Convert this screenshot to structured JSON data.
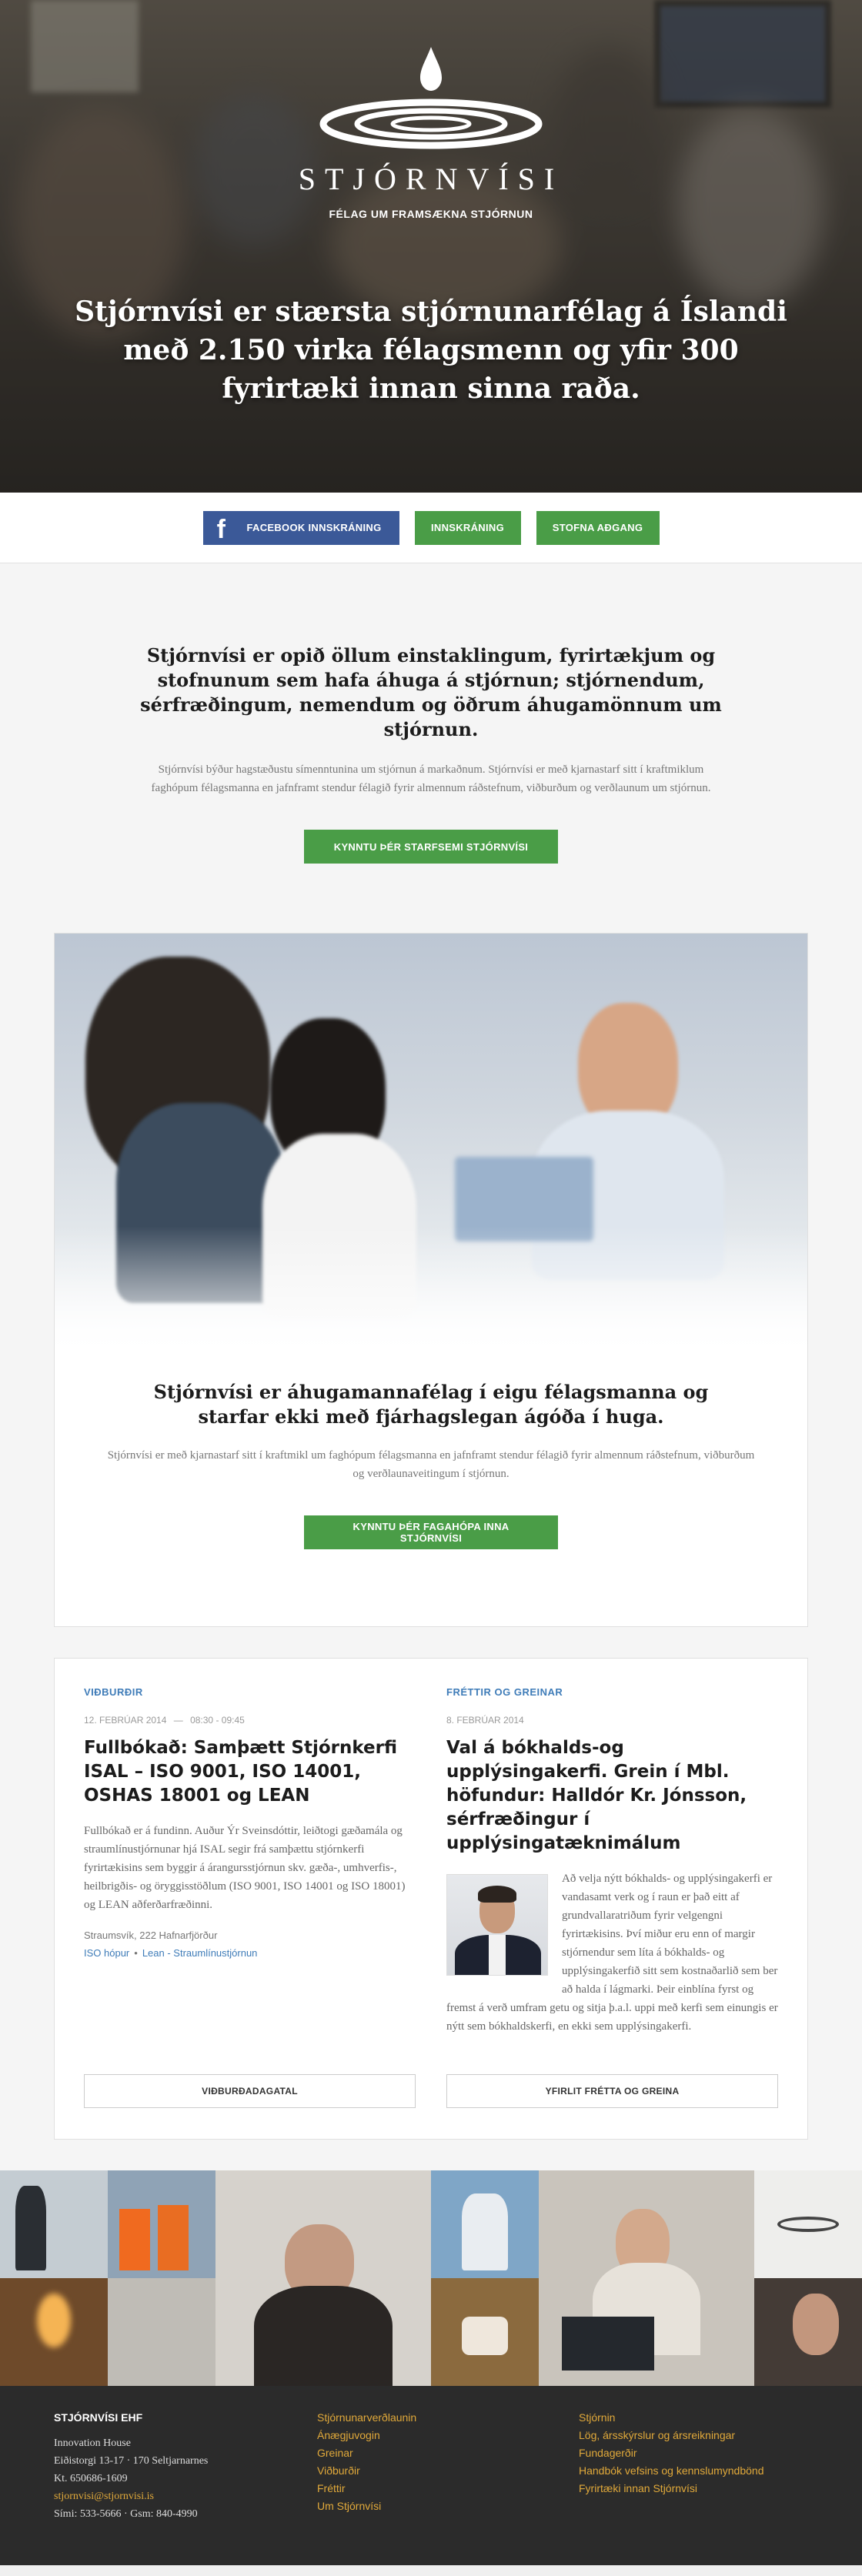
{
  "hero": {
    "wordmark": "STJÓRNVÍSI",
    "tagline": "FÉLAG UM FRAMSÆKNA STJÓRNUN",
    "headline": "Stjórnvísi er stærsta stjórnunarfélag á Íslandi með 2.150 virka félagsmenn og yfir 300 fyrirtæki innan sinna raða."
  },
  "actions": {
    "facebook_label": "FACEBOOK INNSKRÁNING",
    "facebook_glyph": "f",
    "login_label": "INNSKRÁNING",
    "signup_label": "STOFNA AÐGANG"
  },
  "intro": {
    "heading": "Stjórnvísi er opið öllum einstaklingum, fyrirtækjum og stofnunum sem hafa áhuga á stjórnun; stjórnendum, sérfræðingum, nemendum og öðrum áhugamönnum um stjórnun.",
    "body": "Stjórnvísi býður hagstæðustu símenntunina um stjórnun á markaðnum. Stjórnvísi er með kjarnastarf sitt í kraftmiklum faghópum félagsmanna en jafnframt stendur félagið fyrir almennum ráðstefnum, viðburðum og verðlaunum um stjórnun.",
    "cta": "KYNNTU ÞÉR STARFSEMI STJÓRNVÍSI"
  },
  "feature": {
    "heading": "Stjórnvísi er áhugamannafélag í eigu félagsmanna og starfar ekki með fjárhagslegan ágóða í huga.",
    "body": "Stjórnvísi er með kjarnastarf sitt í kraftmikl um faghópum félagsmanna en jafnframt stendur félagið fyrir almennum ráðstefnum, viðburðum og verðlaunaveitingum í stjórnun.",
    "cta": "KYNNTU ÞÉR FAGAHÓPA INNA STJÓRNVÍSI"
  },
  "news": {
    "events": {
      "kicker": "VIÐBURÐIR",
      "date": "12. FEBRÚAR 2014",
      "time": "08:30 - 09:45",
      "title": "Fullbókað: Samþætt Stjórnkerfi ISAL – ISO 9001, ISO 14001, OSHAS 18001 og LEAN",
      "body": "Fullbókað er á fundinn. Auður Ýr Sveinsdóttir, leiðtogi gæðamála og straumlínustjórnunar hjá ISAL segir frá samþættu stjórnkerfi fyrirtækisins sem byggir á árangursstjórnun skv. gæða-, umhverfis-, heilbrigðis- og öryggisstöðlum (ISO 9001, ISO 14001 og ISO 18001) og LEAN aðferðarfræðinni.",
      "location": "Straumsvík, 222 Hafnarfjörður",
      "tags": [
        "ISO hópur",
        "Lean - Straumlínustjórnun"
      ],
      "button": "VIÐBURÐADAGATAL"
    },
    "articles": {
      "kicker": "FRÉTTIR OG GREINAR",
      "date": "8. FEBRÚAR 2014",
      "title": "Val á bókhalds-og upplýsingakerfi. Grein í Mbl. höfundur: Halldór Kr. Jónsson, sérfræðingur í upplýsingatæknimálum",
      "body": "Að velja nýtt bókhalds- og upplýsingakerfi er vandasamt verk og í raun er það eitt af grundvallaratriðum fyrir velgengni fyrirtækisins. Því miður eru enn of margir stjórnendur sem líta á bókhalds- og upplýsingakerfið sitt sem kostnaðarlið sem ber að halda í lágmarki. Þeir einblína fyrst og fremst á verð umfram getu og sitja þ.a.l. uppi með kerfi sem einungis er nýtt sem bókhaldskerfi, en ekki sem upplýsingakerfi.",
      "button": "YFIRLIT FRÉTTA OG GREINA"
    }
  },
  "footer": {
    "company": {
      "title": "STJÓRNVÍSI EHF",
      "lines": [
        "Innovation House",
        "Eiðistorgi 13-17 · 170 Seltjarnarnes",
        "Kt. 650686-1609"
      ],
      "email": "stjornvisi@stjornvisi.is",
      "phone": "Sími: 533-5666 · Gsm: 840-4990"
    },
    "links1": [
      "Stjórnunarverðlaunin",
      "Ánægjuvogin",
      "Greinar",
      "Viðburðir",
      "Fréttir",
      "Um Stjórnvísi"
    ],
    "links2": [
      "Stjórnin",
      "Lög, ársskýrslur og ársreikningar",
      "Fundagerðir",
      "Handbók vefsins og kennslumyndbönd",
      "Fyrirtæki innan Stjórnvísi"
    ]
  },
  "colors": {
    "green": "#4a9d47",
    "facebook": "#3b5998",
    "link": "#3f7cb8",
    "footer_link": "#e1a93a",
    "footer_bg": "#2b2b2b"
  },
  "icons": {
    "logo": "water-drop-ripple-icon",
    "facebook": "facebook-icon"
  }
}
